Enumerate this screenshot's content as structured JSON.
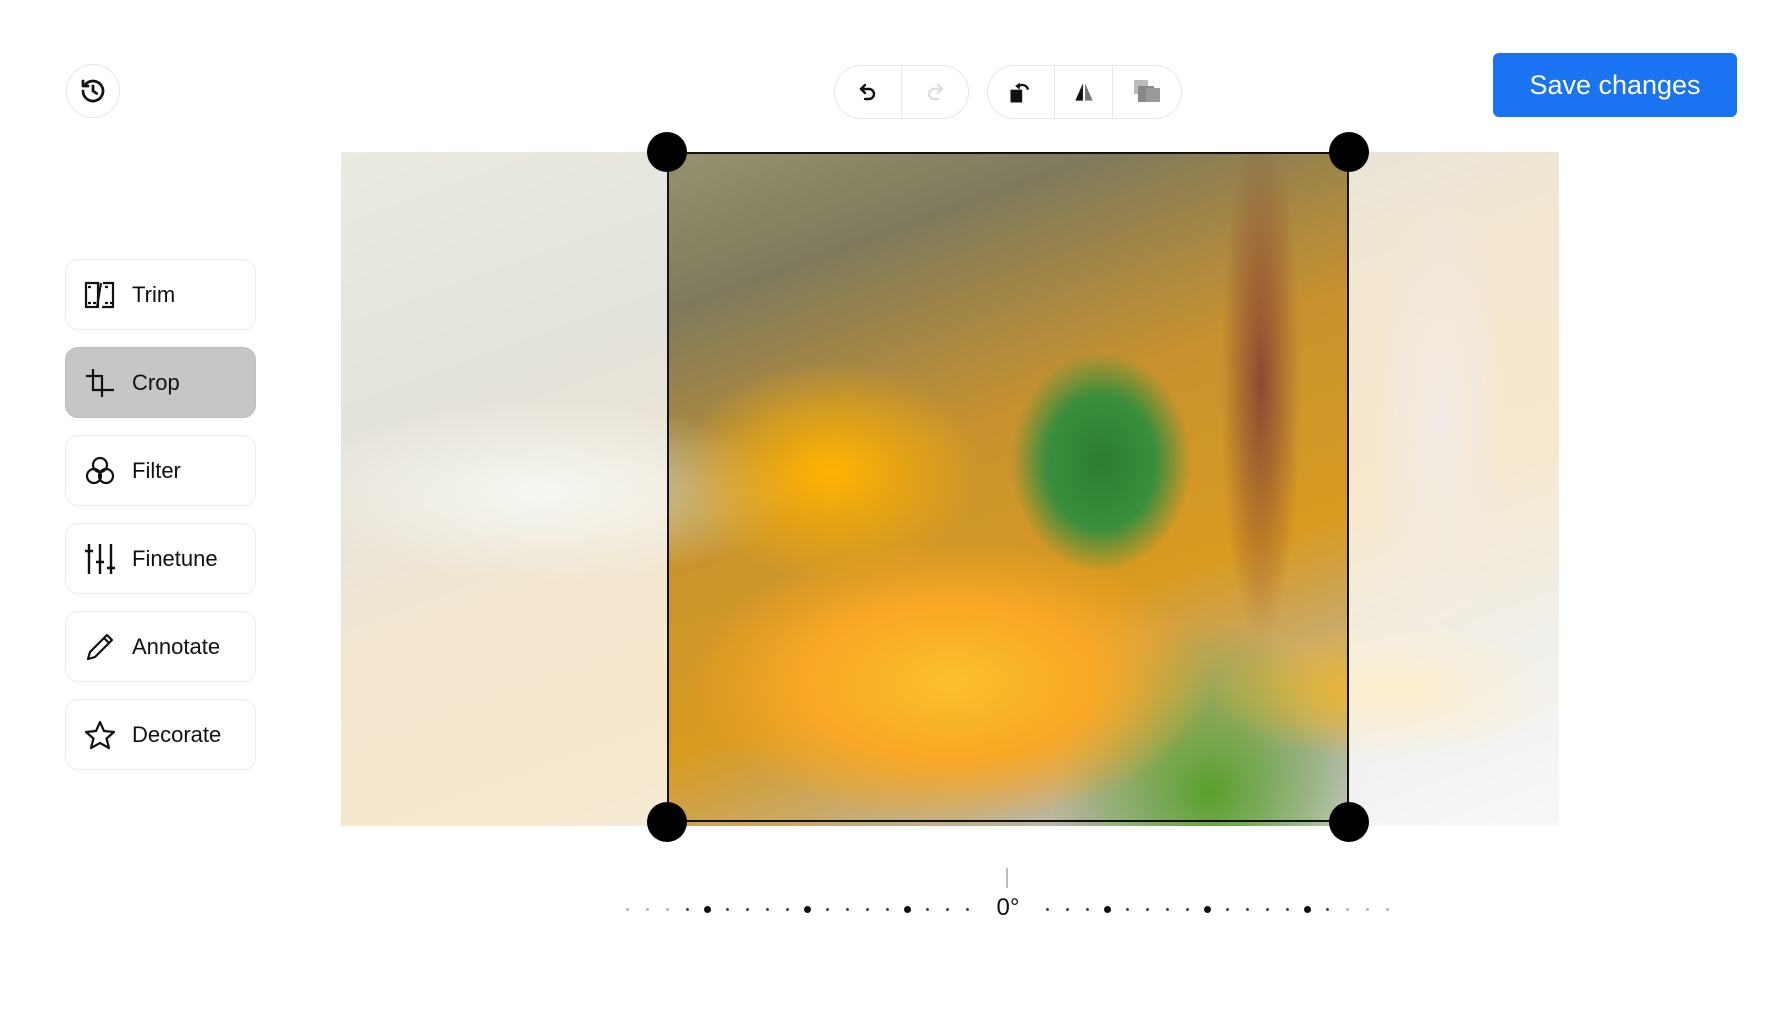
{
  "header": {
    "history_icon": "history-icon",
    "toolbar": [
      {
        "name": "undo",
        "icon": "undo-icon",
        "enabled": true
      },
      {
        "name": "redo",
        "icon": "redo-icon",
        "enabled": false
      },
      {
        "name": "rotate-left",
        "icon": "rotate-left-icon"
      },
      {
        "name": "flip-horizontal",
        "icon": "flip-horizontal-icon"
      },
      {
        "name": "aspect-ratio",
        "icon": "aspect-ratio-icon"
      }
    ],
    "save_label": "Save changes",
    "accent": "#1a73f0"
  },
  "sidebar": {
    "items": [
      {
        "label": "Trim",
        "icon": "film-trim-icon"
      },
      {
        "label": "Crop",
        "icon": "crop-icon",
        "active": true
      },
      {
        "label": "Filter",
        "icon": "filter-circles-icon"
      },
      {
        "label": "Finetune",
        "icon": "sliders-icon"
      },
      {
        "label": "Annotate",
        "icon": "pencil-icon"
      },
      {
        "label": "Decorate",
        "icon": "star-icon"
      }
    ]
  },
  "rotation": {
    "value_label": "0°",
    "value": 0
  }
}
